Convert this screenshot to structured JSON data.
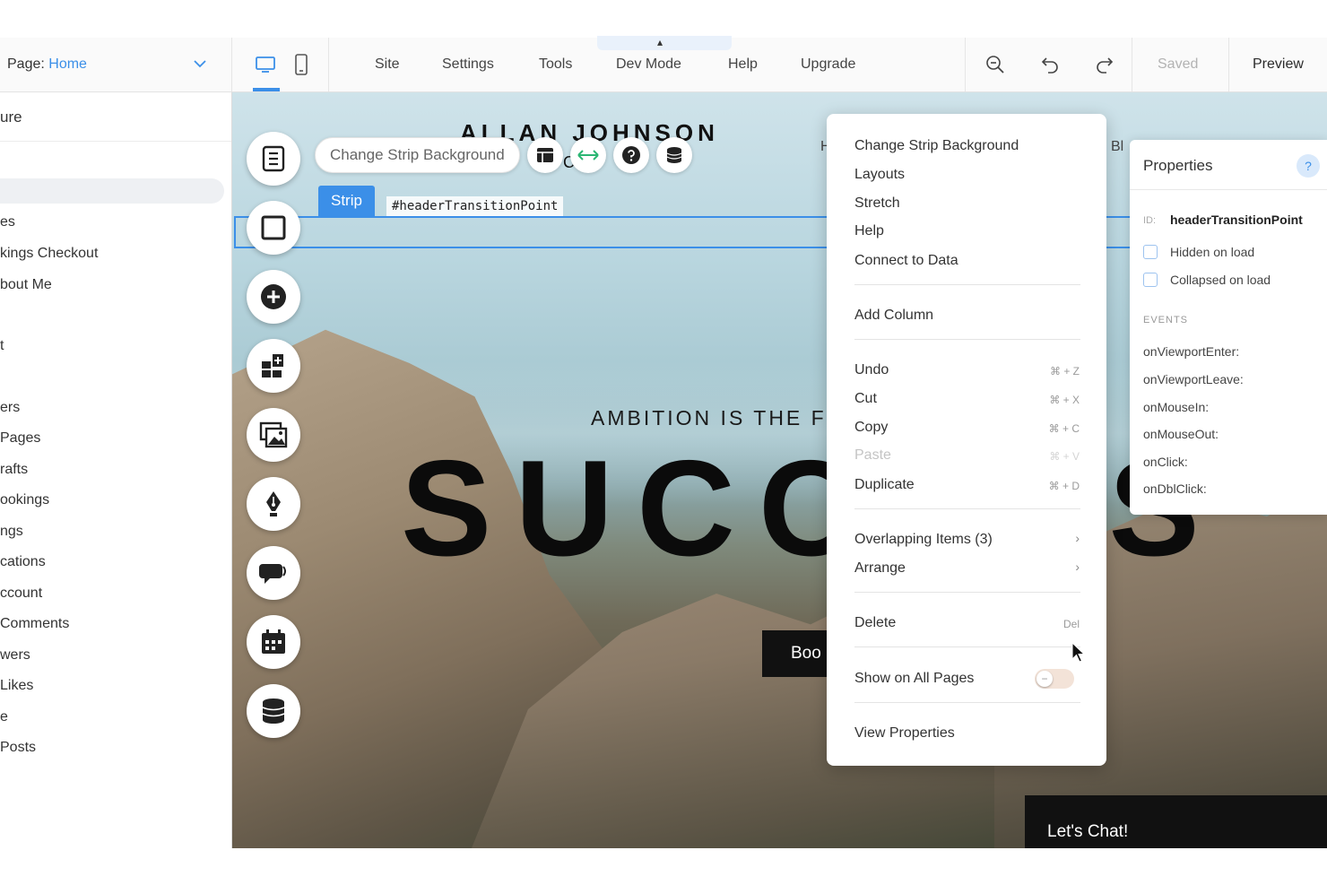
{
  "topbar": {
    "page_label": "Page: ",
    "page_value": "Home",
    "menu": [
      "Site",
      "Settings",
      "Tools",
      "Dev Mode",
      "Help",
      "Upgrade"
    ],
    "saved": "Saved",
    "preview": "Preview",
    "devmode_caret": "▴"
  },
  "left_panel": {
    "header": "ure",
    "items": [
      "es",
      "kings Checkout",
      "bout Me",
      "t",
      "ers",
      "Pages",
      "rafts",
      "ookings",
      "ngs",
      "cations",
      "ccount",
      "Comments",
      "wers",
      "Likes",
      "e",
      "Posts"
    ]
  },
  "canvas": {
    "site_title": "ALLAN JOHNSON",
    "site_subtitle": "rs l   C",
    "nav_partial": "H",
    "nav_blog": "Bl",
    "tagline": "AMBITION IS THE FI",
    "hero_word": "SUCCESS",
    "book_button": "Boo",
    "chat_button": "Let's Chat!"
  },
  "strip": {
    "change_background": "Change Strip Background",
    "tag": "Strip",
    "id": "#headerTransitionPoint"
  },
  "context_menu": {
    "items": [
      {
        "label": "Change Strip Background",
        "shortcut": ""
      },
      {
        "label": "Layouts",
        "shortcut": ""
      },
      {
        "label": "Stretch",
        "shortcut": ""
      },
      {
        "label": "Help",
        "shortcut": ""
      },
      {
        "label": "Connect to Data",
        "shortcut": ""
      },
      {
        "label": "Add Column",
        "shortcut": ""
      },
      {
        "label": "Undo",
        "shortcut": "⌘ + Z"
      },
      {
        "label": "Cut",
        "shortcut": "⌘ + X"
      },
      {
        "label": "Copy",
        "shortcut": "⌘ + C"
      },
      {
        "label": "Paste",
        "shortcut": "⌘ + V"
      },
      {
        "label": "Duplicate",
        "shortcut": "⌘ + D"
      },
      {
        "label": "Overlapping Items (3)",
        "shortcut": "›"
      },
      {
        "label": "Arrange",
        "shortcut": "›"
      },
      {
        "label": "Delete",
        "shortcut": "Del"
      },
      {
        "label": "Show on All Pages",
        "shortcut": ""
      },
      {
        "label": "View Properties",
        "shortcut": ""
      }
    ]
  },
  "properties": {
    "title": "Properties",
    "help": "?",
    "id_label": "ID:",
    "id_value": "headerTransitionPoint",
    "hidden_on_load": "Hidden on load",
    "collapsed_on_load": "Collapsed on load",
    "events_header": "EVENTS",
    "events": [
      "onViewportEnter:",
      "onViewportLeave:",
      "onMouseIn:",
      "onMouseOut:",
      "onClick:",
      "onDblClick:"
    ]
  },
  "colors": {
    "accent": "#3b8fe8",
    "dark_button": "#111111"
  }
}
